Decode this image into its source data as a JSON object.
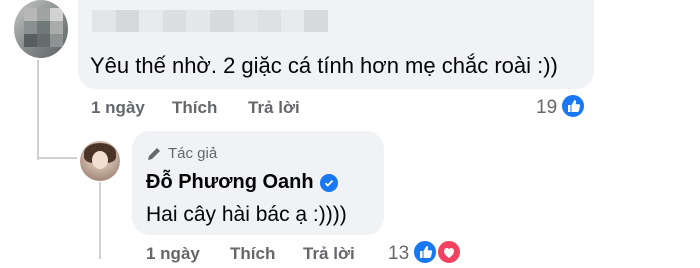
{
  "top_comment": {
    "text": "Yêu thế nhờ. 2 giặc cá tính hơn mẹ chắc roài :))",
    "time": "1 ngày",
    "like_action": "Thích",
    "reply_action": "Trả lời",
    "reaction_count": "19",
    "reactions": [
      "like-icon"
    ]
  },
  "reply": {
    "author_badge": "Tác giả",
    "author_name": "Đỗ Phương Oanh",
    "text": "Hai cây hài bác ạ :))))",
    "time": "1 ngày",
    "like_action": "Thích",
    "reply_action": "Trả lời",
    "reaction_count": "13",
    "reactions": [
      "like-icon",
      "love-icon"
    ]
  },
  "colors": {
    "bubble": "#f0f2f5",
    "meta_text": "#65676b",
    "like_blue": "#1877f2",
    "love_red": "#f3425f",
    "thread_line": "#ced0d4"
  }
}
